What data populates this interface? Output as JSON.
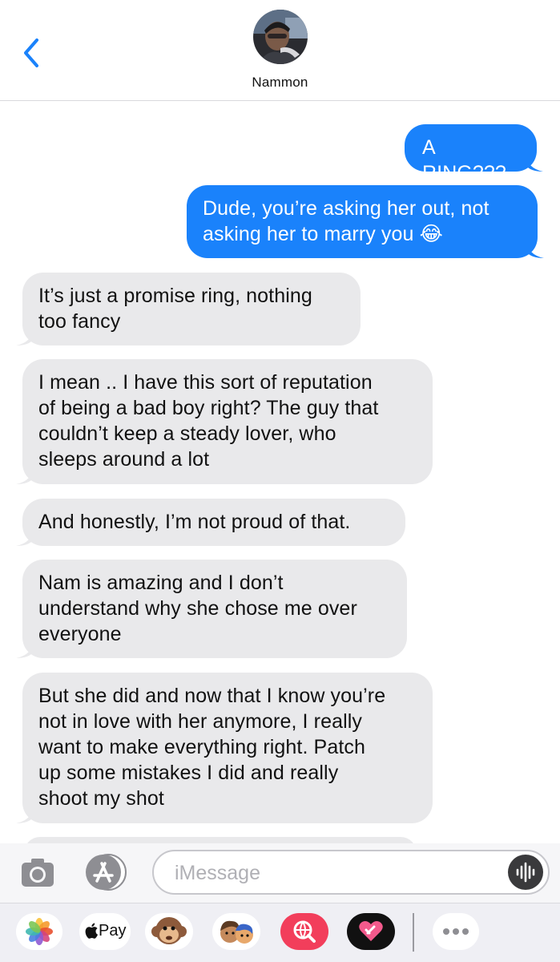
{
  "header": {
    "contact_name": "Nammon"
  },
  "messages": [
    {
      "from": "me",
      "text": "A RING???"
    },
    {
      "from": "me",
      "lines": [
        "Dude, you’re asking her out, not",
        "asking her to marry you 😂"
      ]
    },
    {
      "from": "them",
      "lines": [
        "It’s just a promise ring, nothing",
        "too fancy"
      ]
    },
    {
      "from": "them",
      "lines": [
        "I mean .. I have this sort of reputation",
        "of being a bad boy right? The guy that",
        "couldn’t keep a steady lover, who",
        "sleeps around a lot"
      ]
    },
    {
      "from": "them",
      "text": "And honestly, I’m not proud of that."
    },
    {
      "from": "them",
      "lines": [
        "Nam is amazing and I don’t",
        "understand why she chose me over",
        "everyone"
      ]
    },
    {
      "from": "them",
      "lines": [
        "But she did and now that I know you’re",
        "not in love with her anymore, I really",
        "want to make everything right. Patch",
        "up some mistakes I did and really",
        "shoot my shot"
      ]
    }
  ],
  "composer": {
    "placeholder": "iMessage"
  },
  "app_drawer": {
    "apple_pay_label": "Pay",
    "items": [
      "photos-app",
      "apple-pay-app",
      "animoji-app",
      "memoji-stickers-app",
      "image-search-app",
      "digital-touch-app",
      "more-apps"
    ]
  },
  "colors": {
    "sent_bubble": "#1a82fb",
    "received_bubble": "#e9e9eb",
    "accent": "#1a82fb"
  }
}
